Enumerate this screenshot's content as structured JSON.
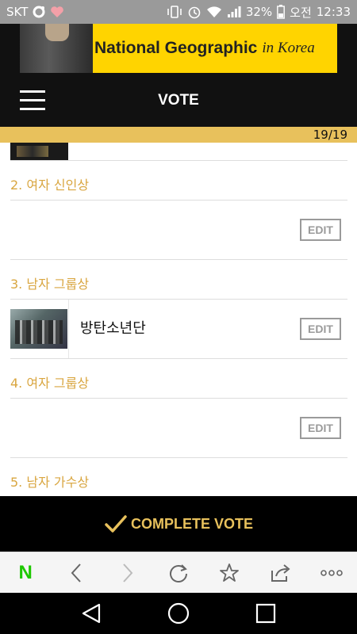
{
  "status_bar": {
    "carrier": "SKT",
    "battery": "32%",
    "ampm": "오전",
    "time": "12:33"
  },
  "header": {
    "banner_brand": "National Geographic",
    "banner_script": "in Korea",
    "title": "VOTE"
  },
  "progress": {
    "text": "19/19",
    "fraction": 1.0
  },
  "categories": [
    {
      "label": "2.  여자 신인상",
      "item": "",
      "edit": "EDIT"
    },
    {
      "label": "3.  남자 그룹상",
      "item": "방탄소년단",
      "edit": "EDIT"
    },
    {
      "label": "4.  여자 그룹상",
      "item": "",
      "edit": "EDIT"
    },
    {
      "label": "5.  남자 가수상"
    }
  ],
  "complete_vote": "COMPLETE VOTE",
  "browser_toolbar": {
    "home_letter": "N",
    "icons": [
      "naver-home-icon",
      "back-icon",
      "forward-icon",
      "reload-icon",
      "bookmark-star-icon",
      "share-icon",
      "more-icon"
    ]
  },
  "android_nav": {
    "icons": [
      "back-triangle-icon",
      "home-circle-icon",
      "recents-square-icon"
    ]
  },
  "colors": {
    "accent": "#e8c15c",
    "category_text": "#d9a640",
    "banner_yellow": "#ffd400",
    "naver_green": "#1ec800"
  }
}
